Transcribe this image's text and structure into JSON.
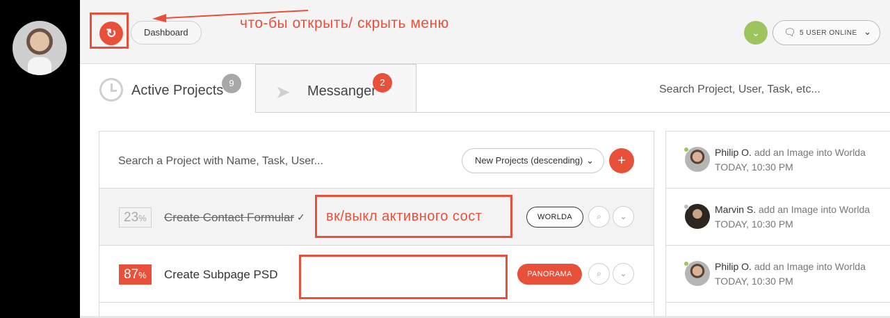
{
  "header": {
    "menu_toggle_icon": "refresh-icon",
    "dashboard_label": "Dashboard",
    "annotation_menu": "что-бы открыть/ скрыть меню",
    "users_online_label": "5 USER ONLINE"
  },
  "tabs": [
    {
      "label": "Active Projects",
      "badge": "9"
    },
    {
      "label": "Messanger",
      "badge": "2"
    }
  ],
  "global_search": {
    "placeholder": "Search Project, User, Task, etc..."
  },
  "projects": {
    "search_placeholder": "Search a Project with Name, Task, User...",
    "sort_label": "New Projects (descending)",
    "add_label": "+",
    "annotation_toggle": "вк/выкл активного сост",
    "rows": [
      {
        "percent": "23",
        "percent_unit": "%",
        "title": "Create Contact Formular",
        "done": true,
        "tag": "WORLDA"
      },
      {
        "percent": "87",
        "percent_unit": "%",
        "title": "Create Subpage PSD",
        "done": false,
        "tag": "PANORAMA"
      }
    ]
  },
  "activity": [
    {
      "user": "Philip O.",
      "action": "add an Image into Worlda",
      "time": "TODAY, 10:30 PM",
      "status": "online"
    },
    {
      "user": "Marvin S.",
      "action": "add an Image into Worlda",
      "time": "TODAY, 10:30 PM",
      "status": "offline"
    },
    {
      "user": "Philip O.",
      "action": "add an Image into Worlda",
      "time": "TODAY, 10:30 PM",
      "status": "online"
    }
  ],
  "colors": {
    "accent": "#e8503a",
    "online": "#9dc45f",
    "sidebar": "#000000"
  }
}
